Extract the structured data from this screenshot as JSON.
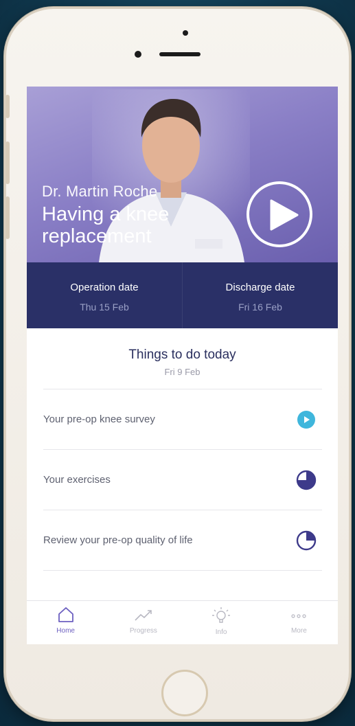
{
  "hero": {
    "doctor_name": "Dr. Martin Roche",
    "video_title_line1": "Having a knee",
    "video_title_line2": "replacement"
  },
  "dates": {
    "operation_label": "Operation date",
    "operation_value": "Thu 15 Feb",
    "discharge_label": "Discharge date",
    "discharge_value": "Fri 16 Feb"
  },
  "todo": {
    "title": "Things to do today",
    "date": "Fri 9 Feb",
    "items": [
      {
        "label": "Your pre-op knee survey",
        "icon": "play-circle-icon"
      },
      {
        "label": "Your exercises",
        "icon": "progress-pie-icon"
      },
      {
        "label": "Review your pre-op quality of life",
        "icon": "progress-pie-icon"
      }
    ]
  },
  "tabs": [
    {
      "label": "Home",
      "icon": "home-icon",
      "active": true
    },
    {
      "label": "Progress",
      "icon": "trend-icon",
      "active": false
    },
    {
      "label": "Info",
      "icon": "lightbulb-icon",
      "active": false
    },
    {
      "label": "More",
      "icon": "more-dots-icon",
      "active": false
    }
  ],
  "colors": {
    "accent": "#6c5fc0",
    "navy": "#2a3067",
    "survey_blue": "#3fb6dc"
  }
}
